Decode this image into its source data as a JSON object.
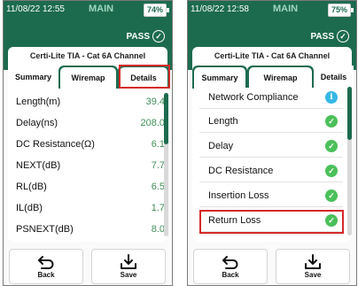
{
  "screens": [
    {
      "status": {
        "time": "11/08/22 12:55",
        "mode": "MAIN",
        "battery": "74%"
      },
      "pass_label": "PASS",
      "channel_title": "Certi-Lite TIA - Cat 6A Channel",
      "tabs": [
        "Summary",
        "Wiremap",
        "Details"
      ],
      "active_tab": "Summary",
      "highlighted_tab": "Details",
      "summary": [
        {
          "label": "Length(m)",
          "value": "39.4"
        },
        {
          "label": "Delay(ns)",
          "value": "208.0"
        },
        {
          "label": "DC Resistance(Ω)",
          "value": "6.1"
        },
        {
          "label": "NEXT(dB)",
          "value": "7.7"
        },
        {
          "label": "RL(dB)",
          "value": "6.5"
        },
        {
          "label": "IL(dB)",
          "value": "1.7"
        },
        {
          "label": "PSNEXT(dB)",
          "value": "8.0"
        }
      ],
      "buttons": {
        "back": "Back",
        "save": "Save"
      }
    },
    {
      "status": {
        "time": "11/08/22 12:58",
        "mode": "MAIN",
        "battery": "75%"
      },
      "pass_label": "PASS",
      "channel_title": "Certi-Lite TIA - Cat 6A Channel",
      "tabs": [
        "Summary",
        "Wiremap",
        "Details"
      ],
      "active_tab": "Details",
      "details": [
        {
          "label": "Network Compliance",
          "status": "info",
          "icon": "info-icon"
        },
        {
          "label": "Length",
          "status": "pass",
          "icon": "check-icon"
        },
        {
          "label": "Delay",
          "status": "pass",
          "icon": "check-icon"
        },
        {
          "label": "DC Resistance",
          "status": "pass",
          "icon": "check-icon"
        },
        {
          "label": "Insertion Loss",
          "status": "pass",
          "icon": "check-icon"
        },
        {
          "label": "Return Loss",
          "status": "pass",
          "icon": "check-icon"
        }
      ],
      "highlighted_row": "Return Loss",
      "buttons": {
        "back": "Back",
        "save": "Save"
      }
    }
  ],
  "colors": {
    "brand_green": "#1d6b4f",
    "pass_green": "#4cc05a",
    "info_blue": "#36b7e6",
    "highlight_red": "#d42a2a",
    "value_green": "#3f8f57"
  }
}
